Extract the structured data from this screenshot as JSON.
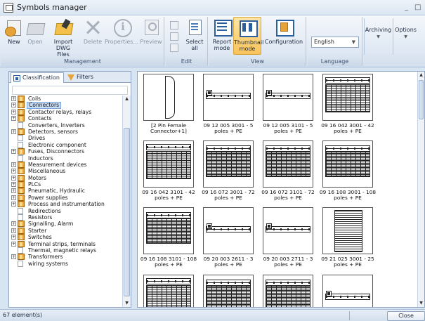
{
  "window": {
    "title": "Symbols manager",
    "min_glyph": "_",
    "max_glyph": "□"
  },
  "ribbon": {
    "groups": {
      "management": "Management",
      "edit": "Edit",
      "view": "View",
      "language": "Language"
    },
    "buttons": {
      "new": "New",
      "open": "Open",
      "import_line1": "Import DWG",
      "import_line2": "Files",
      "delete": "Delete",
      "properties": "Properties...",
      "preview": "Preview",
      "select_line1": "Select",
      "select_line2": "all",
      "report_line1": "Report",
      "report_line2": "mode",
      "thumb_line1": "Thumbnail",
      "thumb_line2": "mode",
      "configuration": "Configuration",
      "archiving": "Archiving",
      "options": "Options"
    },
    "language_value": "English",
    "caret": "▼"
  },
  "left_panel": {
    "tabs": {
      "classification": "Classification",
      "filters": "Filters"
    },
    "tree": [
      {
        "label": "Coils",
        "expandable": true,
        "icon": "book-icon"
      },
      {
        "label": "Connectors",
        "expandable": true,
        "icon": "book-icon",
        "selected": true
      },
      {
        "label": "Contactor relays, relays",
        "expandable": true,
        "icon": "book-icon"
      },
      {
        "label": "Contacts",
        "expandable": true,
        "icon": "book-icon"
      },
      {
        "label": "Converters, Inverters",
        "expandable": false,
        "icon": "page-icon"
      },
      {
        "label": "Detectors, sensors",
        "expandable": true,
        "icon": "book-icon"
      },
      {
        "label": "Drives",
        "expandable": false,
        "icon": "page-icon"
      },
      {
        "label": "Electronic component",
        "expandable": false,
        "icon": "page-icon"
      },
      {
        "label": "Fuses, Disconnectors",
        "expandable": true,
        "icon": "book-icon"
      },
      {
        "label": "Inductors",
        "expandable": false,
        "icon": "page-icon"
      },
      {
        "label": "Measurement devices",
        "expandable": true,
        "icon": "book-icon"
      },
      {
        "label": "Miscellaneous",
        "expandable": true,
        "icon": "book-icon"
      },
      {
        "label": "Motors",
        "expandable": true,
        "icon": "book-icon"
      },
      {
        "label": "PLCs",
        "expandable": true,
        "icon": "book-icon"
      },
      {
        "label": "Pneumatic, Hydraulic",
        "expandable": true,
        "icon": "book-icon"
      },
      {
        "label": "Power supplies",
        "expandable": true,
        "icon": "book-icon"
      },
      {
        "label": "Process and instrumentation",
        "expandable": true,
        "icon": "book-icon"
      },
      {
        "label": "Redirections",
        "expandable": false,
        "icon": "page-icon"
      },
      {
        "label": "Resistors",
        "expandable": false,
        "icon": "page-icon"
      },
      {
        "label": "Signalling, Alarm",
        "expandable": true,
        "icon": "book-icon"
      },
      {
        "label": "Starter",
        "expandable": true,
        "icon": "book-icon"
      },
      {
        "label": "Switches",
        "expandable": true,
        "icon": "book-icon"
      },
      {
        "label": "Terminal strips, terminals",
        "expandable": true,
        "icon": "book-icon"
      },
      {
        "label": "Thermal, magnetic relays",
        "expandable": false,
        "icon": "page-icon"
      },
      {
        "label": "Transformers",
        "expandable": true,
        "icon": "book-icon"
      },
      {
        "label": "wiring systems",
        "expandable": false,
        "icon": "page-icon"
      }
    ]
  },
  "thumbnails": [
    {
      "caption": "[2 Pin Female Connector+1]",
      "drawing": "connector"
    },
    {
      "caption": "09 12 005 3001 - 5 poles + PE",
      "drawing": "header-small"
    },
    {
      "caption": "09 12 005 3101 - 5 poles + PE",
      "drawing": "header-small"
    },
    {
      "caption": "09 16 042 3001 - 42 poles + PE",
      "drawing": "grid"
    },
    {
      "caption": "09 16 042 3101 - 42 poles + PE",
      "drawing": "grid"
    },
    {
      "caption": "09 16 072 3001 - 72 poles + PE",
      "drawing": "grid-dense"
    },
    {
      "caption": "09 16 072 3101 - 72 poles + PE",
      "drawing": "grid-dense"
    },
    {
      "caption": "09 16 108 3001 - 108 poles + PE",
      "drawing": "grid-dense"
    },
    {
      "caption": "09 16 108 3101 - 108 poles + PE",
      "drawing": "grid-dense"
    },
    {
      "caption": "09 20 003 2611 - 3 poles + PE",
      "drawing": "header-small"
    },
    {
      "caption": "09 20 003 2711 - 3 poles + PE",
      "drawing": "header-small"
    },
    {
      "caption": "09 21 025 3001 - 25 poles + PE",
      "drawing": "tall"
    },
    {
      "caption": "",
      "drawing": "grid"
    },
    {
      "caption": "",
      "drawing": "grid-dense"
    },
    {
      "caption": "",
      "drawing": "grid-dense"
    },
    {
      "caption": "",
      "drawing": "header-small"
    }
  ],
  "status": {
    "count": "67 element(s)",
    "close": "Close"
  }
}
